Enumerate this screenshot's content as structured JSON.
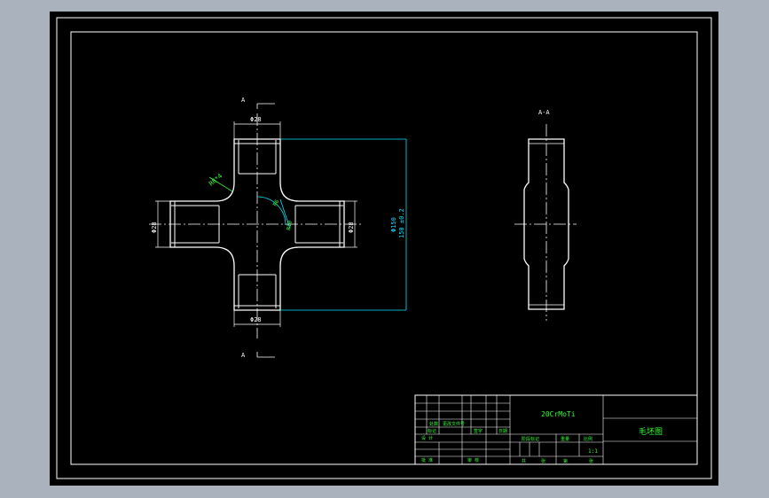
{
  "drawing": {
    "section_marks": {
      "top": "A",
      "bottom": "A"
    },
    "section_view_label": "A-A",
    "dims": {
      "arm_top": "Φ28",
      "arm_bottom": "Φ28",
      "arm_left": "Φ28",
      "arm_right": "Φ28",
      "fillet": "R8*4",
      "arc": "R6",
      "center": "R10",
      "overall_1": "Φ150",
      "overall_2": "150 ±0.2"
    }
  },
  "title_block": {
    "material": "20CrMoTi",
    "drawing_name": "毛坯图",
    "scale": "1:1",
    "row_labels": [
      "标记",
      "处数",
      "更改文件号",
      "签字",
      "日期"
    ],
    "left_roles": [
      "设 计",
      "审 核",
      "批 准"
    ],
    "stage_headers": [
      "阶段标记",
      "重量",
      "比例"
    ],
    "sheet_labels": [
      "共",
      "张",
      "第",
      "张"
    ]
  },
  "colors": {
    "background": "#aab3bd",
    "canvas": "#000000",
    "outline": "#ffffff",
    "text": "#33ff33",
    "dimension": "#00e5ff"
  }
}
